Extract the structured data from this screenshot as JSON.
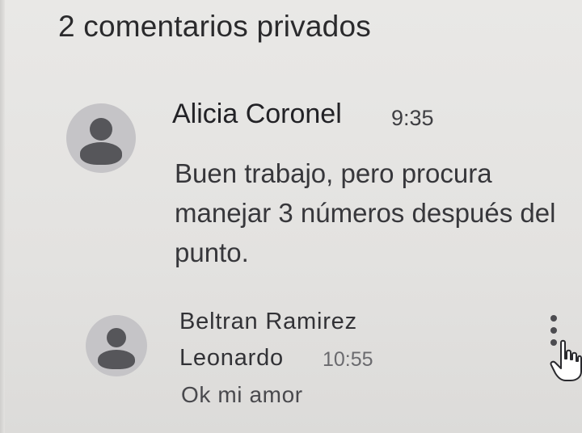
{
  "header": {
    "title": "2 comentarios privados"
  },
  "comments": [
    {
      "author": "Alicia Coronel",
      "time": "9:35",
      "text": "Buen trabajo, pero procura manejar 3 números después del punto.",
      "avatar_icon": "default-avatar-icon"
    },
    {
      "author_line1": "Beltran Ramirez",
      "author_line2": "Leonardo",
      "time": "10:55",
      "text": "Ok mi amor",
      "avatar_icon": "default-avatar-icon",
      "menu_icon": "more-vert-icon"
    }
  ],
  "cursor_icon": "hand-pointer-icon",
  "colors": {
    "background": "#e4e3e1",
    "avatar_bg": "#c5c4c7",
    "avatar_fg": "#56565a",
    "text_primary": "#222226",
    "text_secondary": "#6a6a6e"
  }
}
